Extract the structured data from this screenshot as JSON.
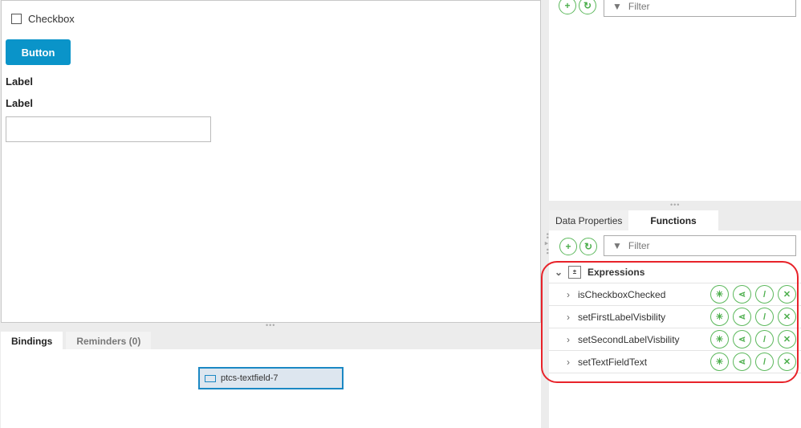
{
  "canvas": {
    "checkbox_label": "Checkbox",
    "checkbox_checked": false,
    "button_label": "Button",
    "label1": "Label",
    "label2": "Label",
    "textfield_value": ""
  },
  "bottom": {
    "tabs": [
      {
        "label": "Bindings",
        "active": true
      },
      {
        "label": "Reminders (0)",
        "active": false
      }
    ],
    "binding_chip": "ptcs-textfield-7"
  },
  "right_top": {
    "filter_placeholder": "Filter"
  },
  "right": {
    "tabs": [
      {
        "label": "Data Properties",
        "active": false
      },
      {
        "label": "Functions",
        "active": true
      }
    ],
    "filter_placeholder": "Filter",
    "group": "Expressions",
    "functions": [
      "isCheckboxChecked",
      "setFirstLabelVisbility",
      "setSecondLabelVisbility",
      "setTextFieldText"
    ]
  },
  "colors": {
    "accent": "#0a94c9",
    "green": "#4cae4c",
    "highlight": "#e8232a"
  }
}
